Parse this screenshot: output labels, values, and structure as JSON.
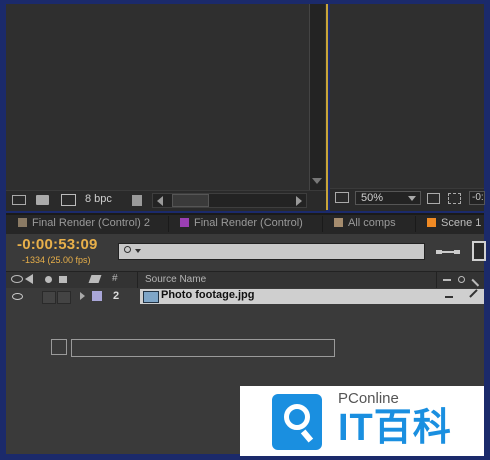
{
  "footage_panel": {
    "bit_depth": "8 bpc"
  },
  "viewer_panel": {
    "zoom": "50%",
    "timecode_partial": "-0:0"
  },
  "tabs": [
    {
      "label": "Final Render (Control) 2",
      "color": "#8a7a64"
    },
    {
      "label": "Final Render (Control)",
      "color": "#9b3fb3"
    },
    {
      "label": "All comps",
      "color": "#a58c6e"
    },
    {
      "label": "Scene 1",
      "color": "#f08a24"
    }
  ],
  "timeline": {
    "timecode": "-0:00:53:09",
    "frame_info": "-1334 (25.00 fps)",
    "search_placeholder": "",
    "columns": {
      "number": "#",
      "source_name": "Source Name"
    },
    "layers": [
      {
        "index": "2",
        "name": "Photo footage.jpg",
        "label_color": "#a9a6d8"
      }
    ]
  },
  "colors": {
    "accent_timecode": "#e8b04a",
    "panel_bg": "#2f2f2f",
    "frame_border": "#1b2a6b"
  },
  "watermark": {
    "brand": "PConline",
    "brand_cn": "IT百科"
  }
}
